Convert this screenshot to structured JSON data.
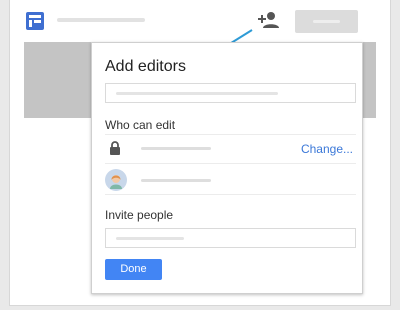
{
  "app": {
    "logo_icon": "calendar-layout-icon",
    "add_person_icon": "person-add-icon",
    "accent_color": "#3f6fd1"
  },
  "dialog": {
    "title": "Add editors",
    "who_can_edit_label": "Who can edit",
    "lock_icon": "lock-icon",
    "change_link": "Change...",
    "avatar_icon": "user-avatar-icon",
    "invite_label": "Invite people",
    "done_button": "Done",
    "button_color": "#4285f4",
    "link_color": "#3b78d8"
  },
  "callout": {
    "arrow_color": "#2e9bd6"
  }
}
